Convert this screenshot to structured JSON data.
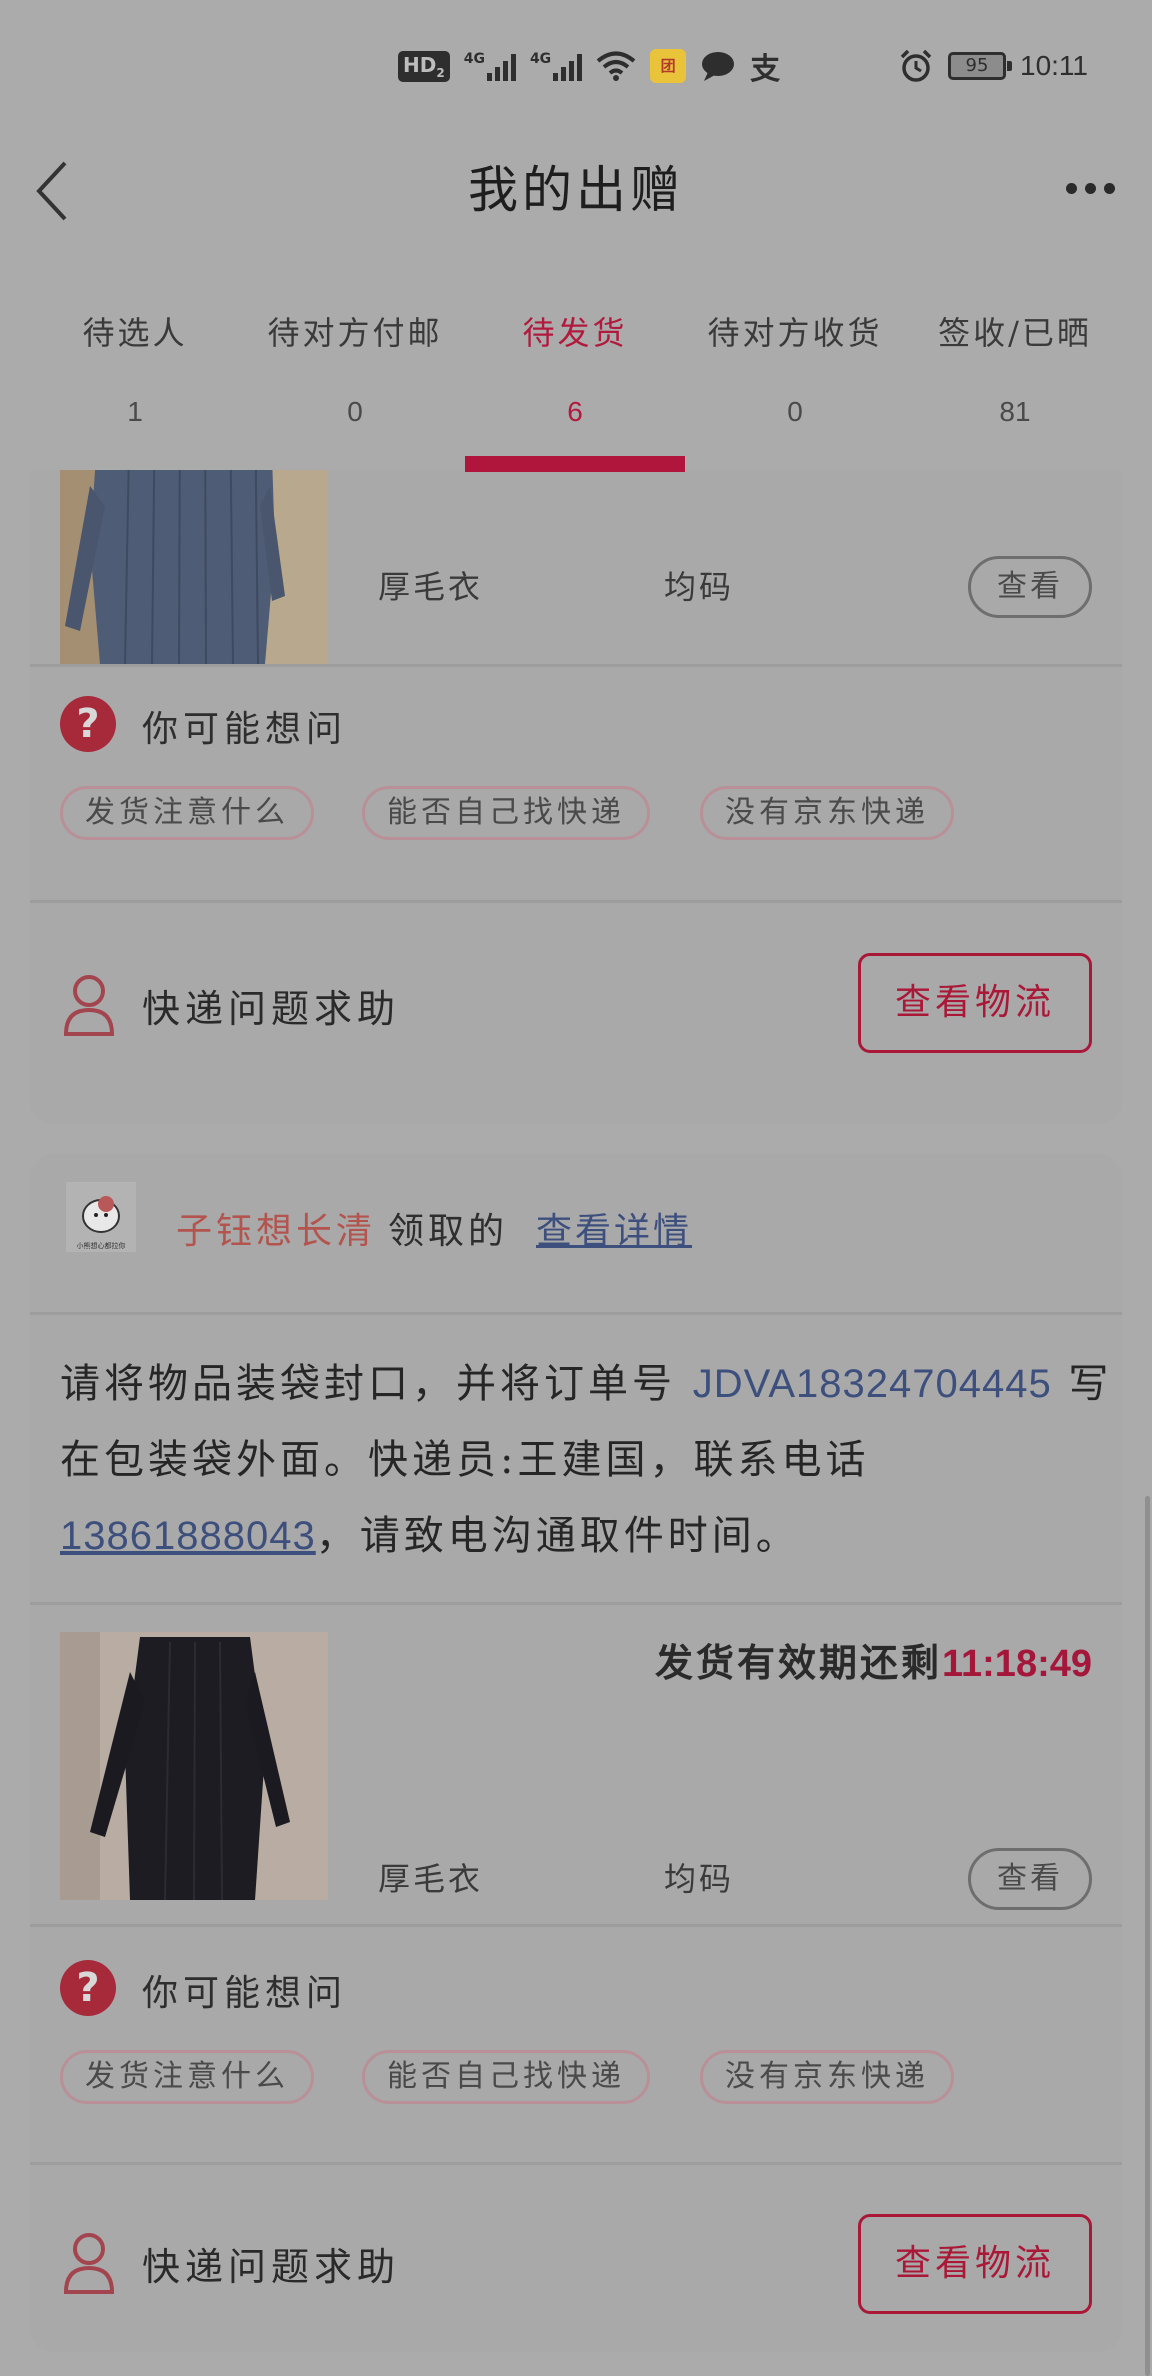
{
  "status_bar": {
    "hd": "HD",
    "hd_sub": "2",
    "net1": "4G",
    "net2": "4G",
    "tuan": "团",
    "zhi": "支",
    "battery": "95",
    "time": "10:11"
  },
  "header": {
    "title": "我的出赠"
  },
  "tabs": [
    {
      "label": "待选人",
      "count": "1"
    },
    {
      "label": "待对方付邮",
      "count": "0"
    },
    {
      "label": "待发货",
      "count": "6",
      "active": true
    },
    {
      "label": "待对方收货",
      "count": "0"
    },
    {
      "label": "签收/已晒",
      "count": "81"
    }
  ],
  "colors": {
    "accent": "#b0163c",
    "link": "#3d4f7d"
  },
  "card1": {
    "item": {
      "name": "厚毛衣",
      "size": "均码",
      "view_label": "查看",
      "photo": "blue-knit-dress"
    },
    "faq": {
      "title": "你可能想问",
      "chips": [
        "发货注意什么",
        "能否自己找快递",
        "没有京东快递"
      ]
    },
    "help": {
      "label": "快递问题求助",
      "logistics_label": "查看物流"
    }
  },
  "card2": {
    "header": {
      "claimer": "子钰想长清",
      "claim_text": "领取的",
      "detail_link": "查看详情",
      "avatar_caption": "小熊想心都拉你"
    },
    "instructions": {
      "part1": "请将物品装袋封口，并将订单号 ",
      "order_no": "JDVA18324704445",
      "part2": " 写在包装袋外面。快递员:王建国，联系电话",
      "phone": "13861888043",
      "part3": "，请致电沟通取件时间。"
    },
    "deadline": {
      "label": "发货有效期还剩",
      "time": "11:18:49"
    },
    "item": {
      "name": "厚毛衣",
      "size": "均码",
      "view_label": "查看",
      "photo": "black-knit-dress"
    },
    "faq": {
      "title": "你可能想问",
      "chips": [
        "发货注意什么",
        "能否自己找快递",
        "没有京东快递"
      ]
    },
    "help": {
      "label": "快递问题求助",
      "logistics_label": "查看物流"
    }
  }
}
